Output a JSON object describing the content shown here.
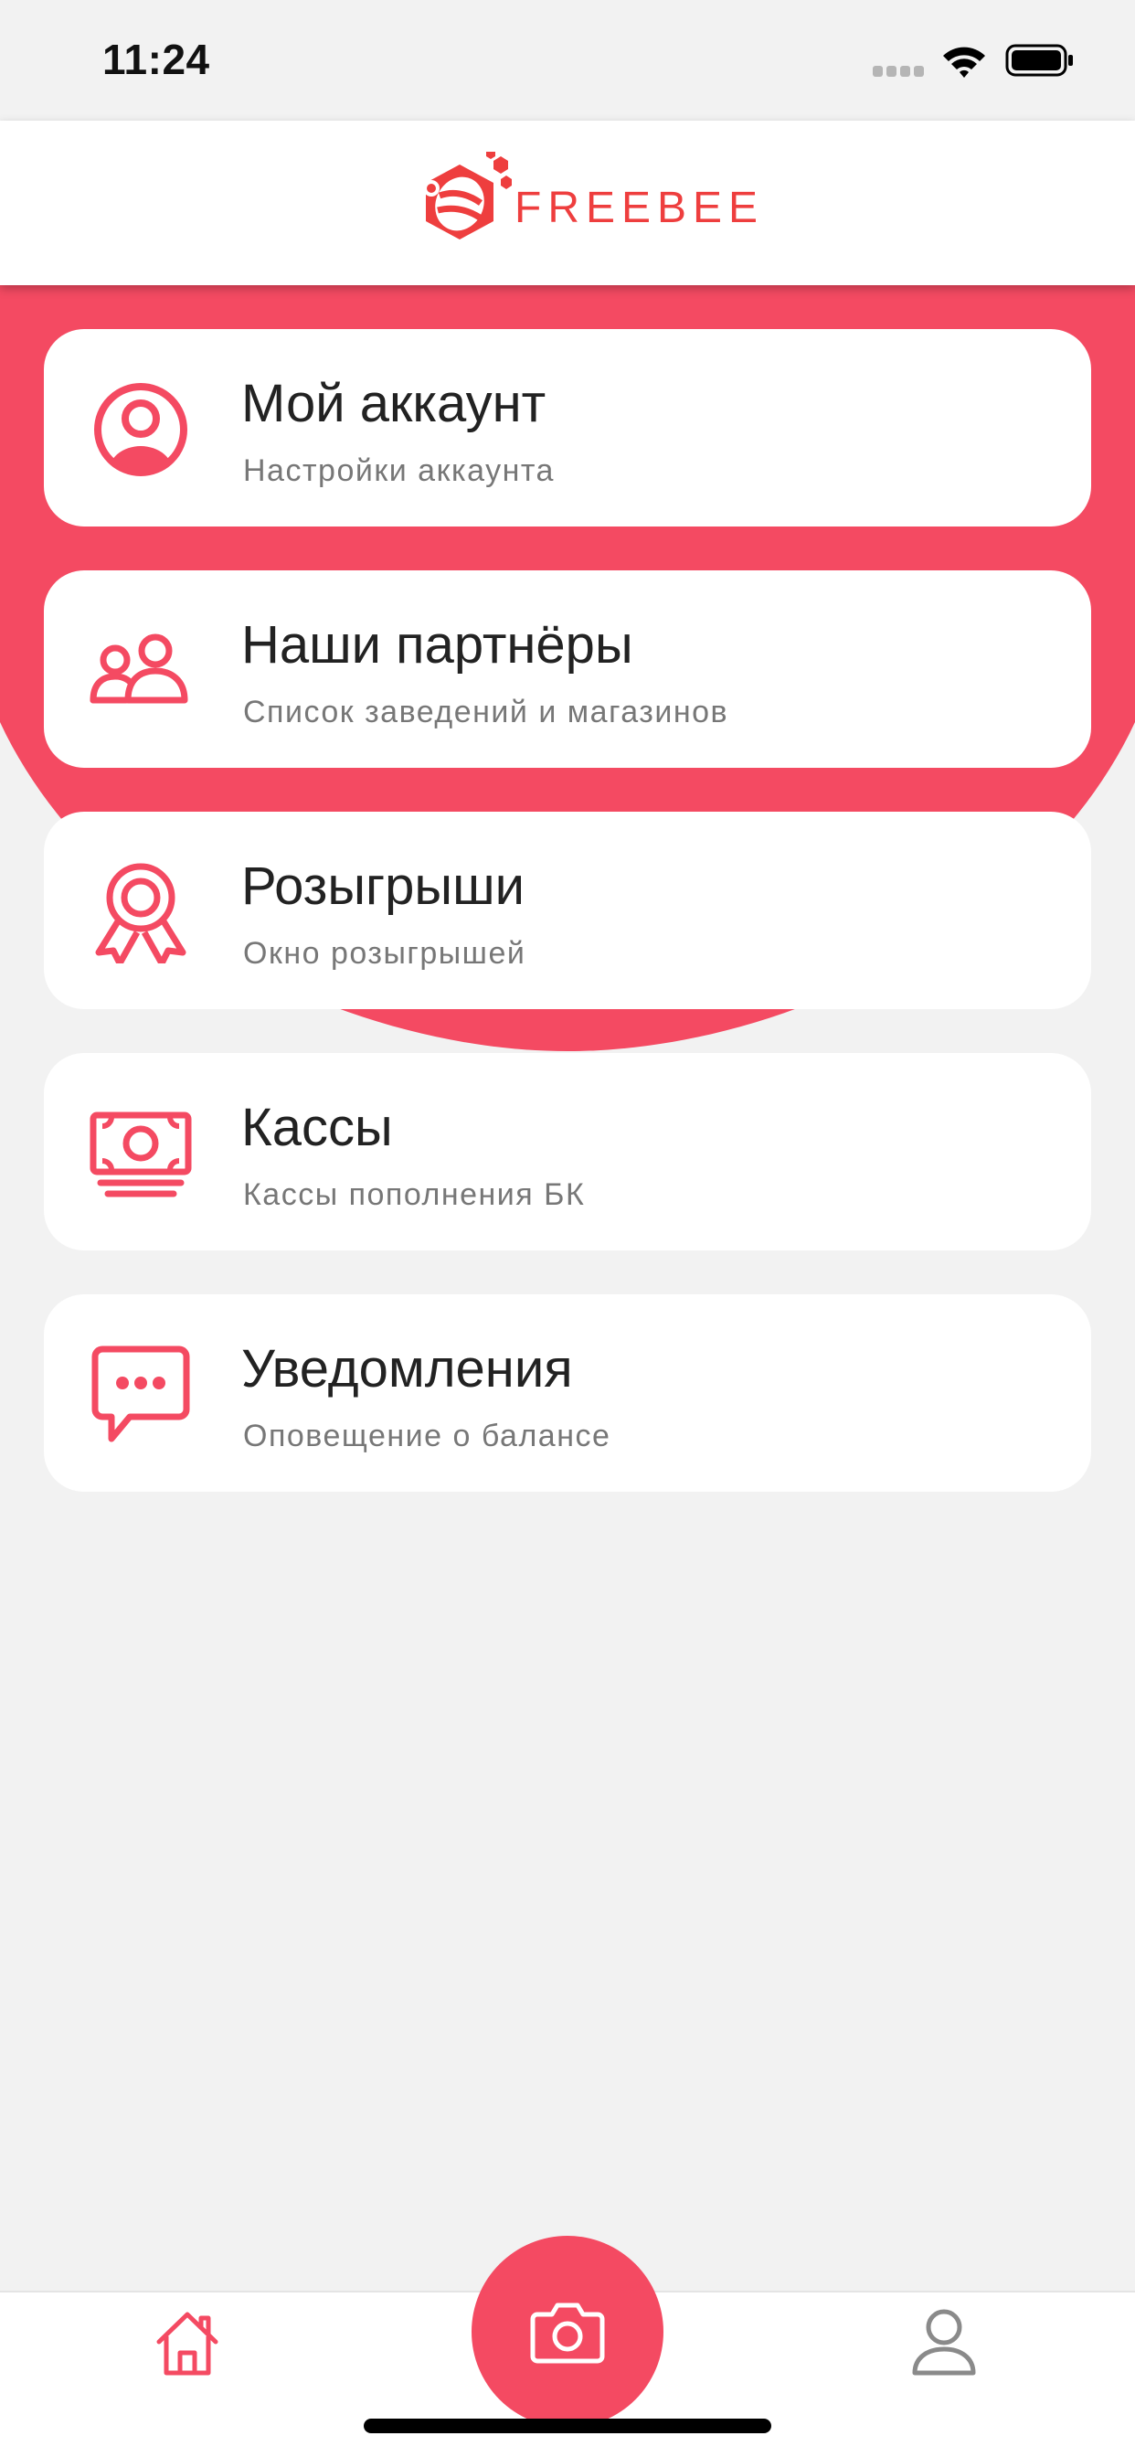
{
  "status_bar": {
    "time": "11:24"
  },
  "header": {
    "logo_text": "FREEBEE"
  },
  "colors": {
    "accent": "#f44a62",
    "logo_red": "#ee3e3e",
    "background": "#f2f2f2",
    "card": "#ffffff",
    "title_text": "#222222",
    "subtitle_text": "#777777",
    "nav_inactive": "#8a8a8a"
  },
  "menu": {
    "items": [
      {
        "icon": "user-circle-icon",
        "title": "Мой аккаунт",
        "subtitle": "Настройки аккаунта"
      },
      {
        "icon": "users-icon",
        "title": "Наши партнёры",
        "subtitle": "Список заведений и магазинов"
      },
      {
        "icon": "award-ribbon-icon",
        "title": "Розыгрыши",
        "subtitle": "Окно розыгрышей"
      },
      {
        "icon": "money-bill-icon",
        "title": "Кассы",
        "subtitle": "Кассы пополнения БК"
      },
      {
        "icon": "chat-bubble-icon",
        "title": "Уведомления",
        "subtitle": "Оповещение о балансе"
      }
    ]
  },
  "bottom_nav": {
    "items": [
      {
        "icon": "home-icon",
        "active": true
      },
      {
        "icon": "camera-icon",
        "active": false
      },
      {
        "icon": "user-icon",
        "active": false
      }
    ]
  }
}
